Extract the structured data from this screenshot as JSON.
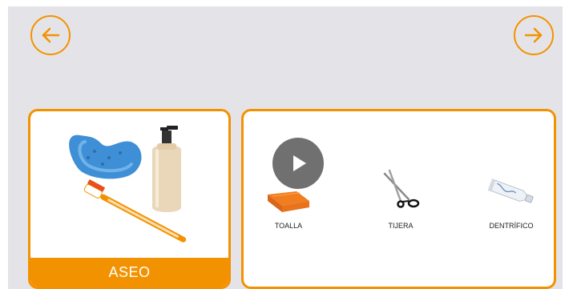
{
  "navigation": {
    "back_icon": "arrow-left-icon",
    "forward_icon": "arrow-right-icon"
  },
  "category": {
    "label": "ASEO",
    "image": "sponge-soap-toothbrush-image"
  },
  "items_panel": {
    "play_icon": "play-icon",
    "items": [
      {
        "label": "TOALLA",
        "icon": "towel-icon"
      },
      {
        "label": "TIJERA",
        "icon": "scissors-icon"
      },
      {
        "label": "DENTRÍFICO",
        "icon": "toothpaste-icon"
      }
    ]
  },
  "colors": {
    "accent": "#f39200",
    "background": "#e4e4e8",
    "card": "#ffffff"
  }
}
